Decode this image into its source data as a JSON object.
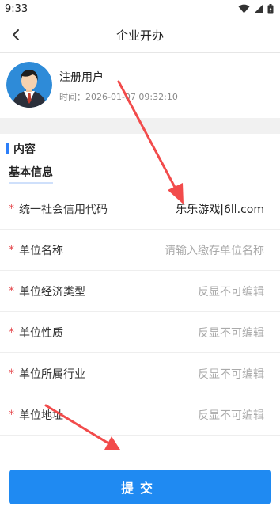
{
  "status": {
    "time": "9:33"
  },
  "nav": {
    "title": "企业开办"
  },
  "profile": {
    "name": "注册用户",
    "time": "时间：2026-01-07 09:32:10"
  },
  "section": {
    "title": "内容",
    "subtitle": "基本信息"
  },
  "form": {
    "rows": [
      {
        "label": "统一社会信用代码",
        "value": "乐乐游戏|6ll.com"
      },
      {
        "label": "单位名称",
        "value": "请输入缴存单位名称"
      },
      {
        "label": "单位经济类型",
        "value": "反显不可编辑"
      },
      {
        "label": "单位性质",
        "value": "反显不可编辑"
      },
      {
        "label": "单位所属行业",
        "value": "反显不可编辑"
      },
      {
        "label": "单位地址",
        "value": "反显不可编辑"
      }
    ]
  },
  "required_mark": "*",
  "submit": {
    "label": "提交"
  },
  "colors": {
    "accent": "#1f8af2",
    "required": "#e5484d",
    "annotation": "#f24b4b"
  }
}
